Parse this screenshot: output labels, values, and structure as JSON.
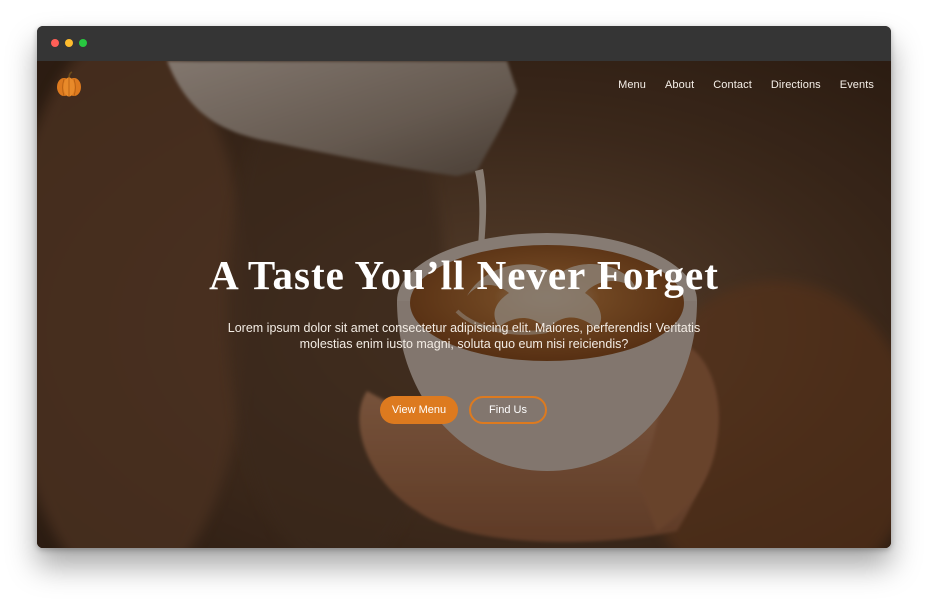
{
  "window": {
    "titlebar_color": "#353535",
    "controls": [
      "close",
      "minimize",
      "maximize"
    ],
    "control_colors": {
      "close": "#ff5f57",
      "minimize": "#febc2e",
      "maximize": "#28c840"
    }
  },
  "brand": {
    "logo_icon": "pumpkin-icon",
    "accent": "#dd7a1f"
  },
  "nav": {
    "items": [
      {
        "label": "Menu"
      },
      {
        "label": "About"
      },
      {
        "label": "Contact"
      },
      {
        "label": "Directions"
      },
      {
        "label": "Events"
      }
    ]
  },
  "hero": {
    "title": "A Taste You’ll Never Forget",
    "subtitle": "Lorem ipsum dolor sit amet consectetur adipisicing elit. Maiores, perferendis! Veritatis molestias enim iusto magni, soluta quo eum nisi reiciendis?",
    "primary_button": "View Menu",
    "secondary_button": "Find Us",
    "background_image": "latte-art-pour"
  }
}
